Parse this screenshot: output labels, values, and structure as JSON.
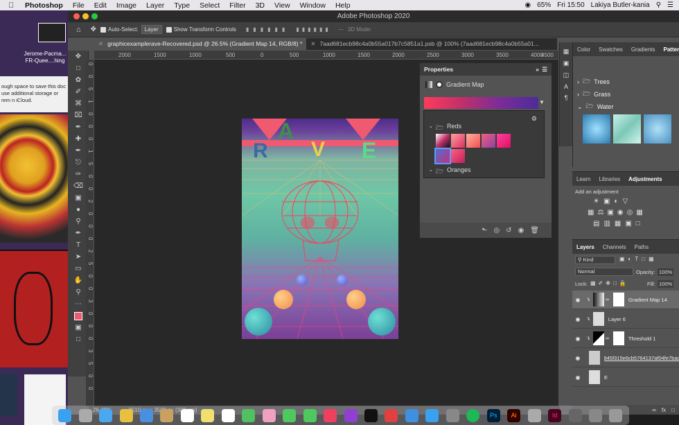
{
  "menubar": {
    "app": "Photoshop",
    "items": [
      "File",
      "Edit",
      "Image",
      "Layer",
      "Type",
      "Select",
      "Filter",
      "3D",
      "View",
      "Window",
      "Help"
    ],
    "battery": "65%",
    "clock": "Fri 15:50",
    "user": "Lakiya Butler-kania"
  },
  "desktop": {
    "item_label": "Jerome-Pacma... FR-Quee....hing",
    "notice": "ough space to save this doc use additional storage or rem n iCloud."
  },
  "window": {
    "title": "Adobe Photoshop 2020"
  },
  "options": {
    "auto_select": "Auto-Select:",
    "layer_select": "Layer",
    "transform": "Show Transform Controls",
    "mode3d": "3D Mode:"
  },
  "tabs": [
    {
      "label": "graphicexamplerave-Recovered.psd @ 26.5% (Gradient Map 14, RGB/8) *",
      "active": true
    },
    {
      "label": "7aad681ecb98c4a0b55a017b7c5851a1.psb @ 100% (7aad681ecb98c4a0b55a01...",
      "active": false
    }
  ],
  "ruler_h": [
    "2000",
    "1500",
    "1000",
    "500",
    "0",
    "500",
    "1000",
    "1500",
    "2000",
    "2500",
    "3000",
    "3500",
    "4000",
    "4500"
  ],
  "ruler_v": [
    "0",
    "0",
    "5",
    "1",
    "0",
    "0",
    "0",
    "1",
    "5",
    "0",
    "0",
    "2",
    "0",
    "0",
    "0",
    "2",
    "5",
    "0",
    "0",
    "3",
    "0",
    "0",
    "0",
    "3",
    "5",
    "0",
    "0"
  ],
  "poster": {
    "letters": [
      "R",
      "A",
      "V",
      "E"
    ]
  },
  "status": {
    "zoom": "26.49%",
    "doc_size": "2510 px x 3508 px (300 ppi)"
  },
  "properties": {
    "title": "Properties",
    "adjust_name": "Gradient Map",
    "folder1": "Reds",
    "folder2": "Oranges"
  },
  "patterns_panel": {
    "tabs": [
      "Color",
      "Swatches",
      "Gradients",
      "Patterns"
    ],
    "folders": [
      "Trees",
      "Grass",
      "Water"
    ]
  },
  "adjustments_panel": {
    "tabs": [
      "Learn",
      "Libraries",
      "Adjustments"
    ],
    "add_label": "Add an adjustment"
  },
  "layers_panel": {
    "tabs": [
      "Layers",
      "Channels",
      "Paths"
    ],
    "filter": "Kind",
    "blend": "Normal",
    "opacity_label": "Opacity:",
    "opacity": "100%",
    "lock_label": "Lock:",
    "fill_label": "Fill:",
    "fill": "100%",
    "layers": [
      {
        "name": "Gradient Map 14"
      },
      {
        "name": "Layer 6"
      },
      {
        "name": "Threshold 1"
      },
      {
        "name": "845f315e6cb5764137af04fe7bac"
      },
      {
        "name": "E"
      }
    ]
  },
  "colors": {
    "accent": "#f05a70",
    "teal": "#6ec7a6",
    "purple": "#7b3f97"
  }
}
